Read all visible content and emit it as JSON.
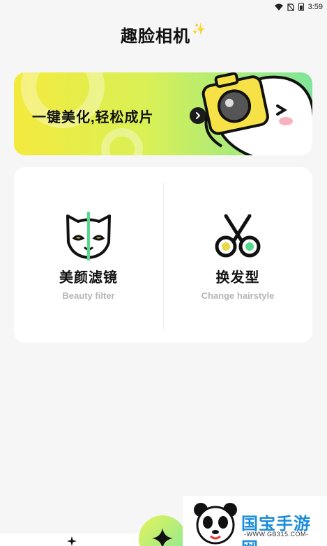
{
  "status_bar": {
    "time": "3:59"
  },
  "header": {
    "title": "趣脸相机",
    "sparkle_icon": "sparkle-icon"
  },
  "banner": {
    "text": "一键美化,轻松成片",
    "arrow_icon": "chevron-right-icon",
    "colors": {
      "start": "#f4ea3e",
      "end": "#7fe59a"
    }
  },
  "features": [
    {
      "title": "美颜滤镜",
      "subtitle": "Beauty filter",
      "icon": "cat-mask-icon"
    },
    {
      "title": "换发型",
      "subtitle": "Change hairstyle",
      "icon": "scissors-icon"
    }
  ],
  "fab": {
    "icon": "star-icon"
  },
  "watermark": {
    "text": "国宝手游网",
    "url": "-WWW.GB315.COM-"
  }
}
